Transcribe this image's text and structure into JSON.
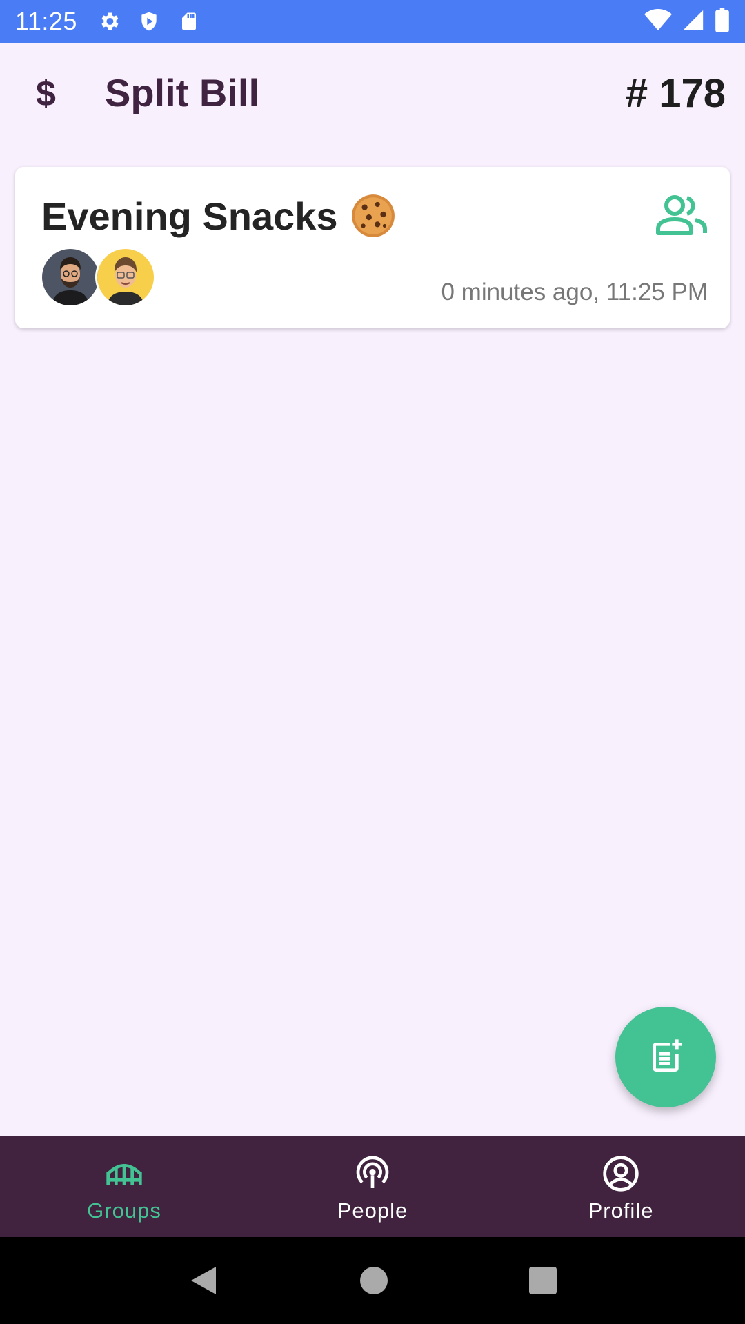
{
  "status_bar": {
    "time": "11:25",
    "icons_left": [
      "gear-icon",
      "shield-icon",
      "sd-card-icon"
    ],
    "icons_right": [
      "wifi-icon",
      "signal-icon",
      "battery-icon"
    ],
    "background": "#4a7cf5"
  },
  "app_bar": {
    "icon": "$",
    "title": "Split Bill",
    "count": "# 178"
  },
  "groups": [
    {
      "name": "Evening Snacks",
      "emoji": "cookie",
      "members": [
        "member-avatar-1",
        "member-avatar-2"
      ],
      "time": "0 minutes ago, 11:25 PM"
    }
  ],
  "fab": {
    "icon": "add-note-icon",
    "color": "#43c393"
  },
  "bottom_nav": {
    "items": [
      {
        "label": "Groups",
        "icon": "bridge-icon",
        "active": true
      },
      {
        "label": "People",
        "icon": "broadcast-icon",
        "active": false
      },
      {
        "label": "Profile",
        "icon": "account-circle-icon",
        "active": false
      }
    ],
    "background": "#41233f",
    "active_color": "#43c393"
  },
  "system_nav": [
    "back-icon",
    "home-icon",
    "recents-icon"
  ]
}
